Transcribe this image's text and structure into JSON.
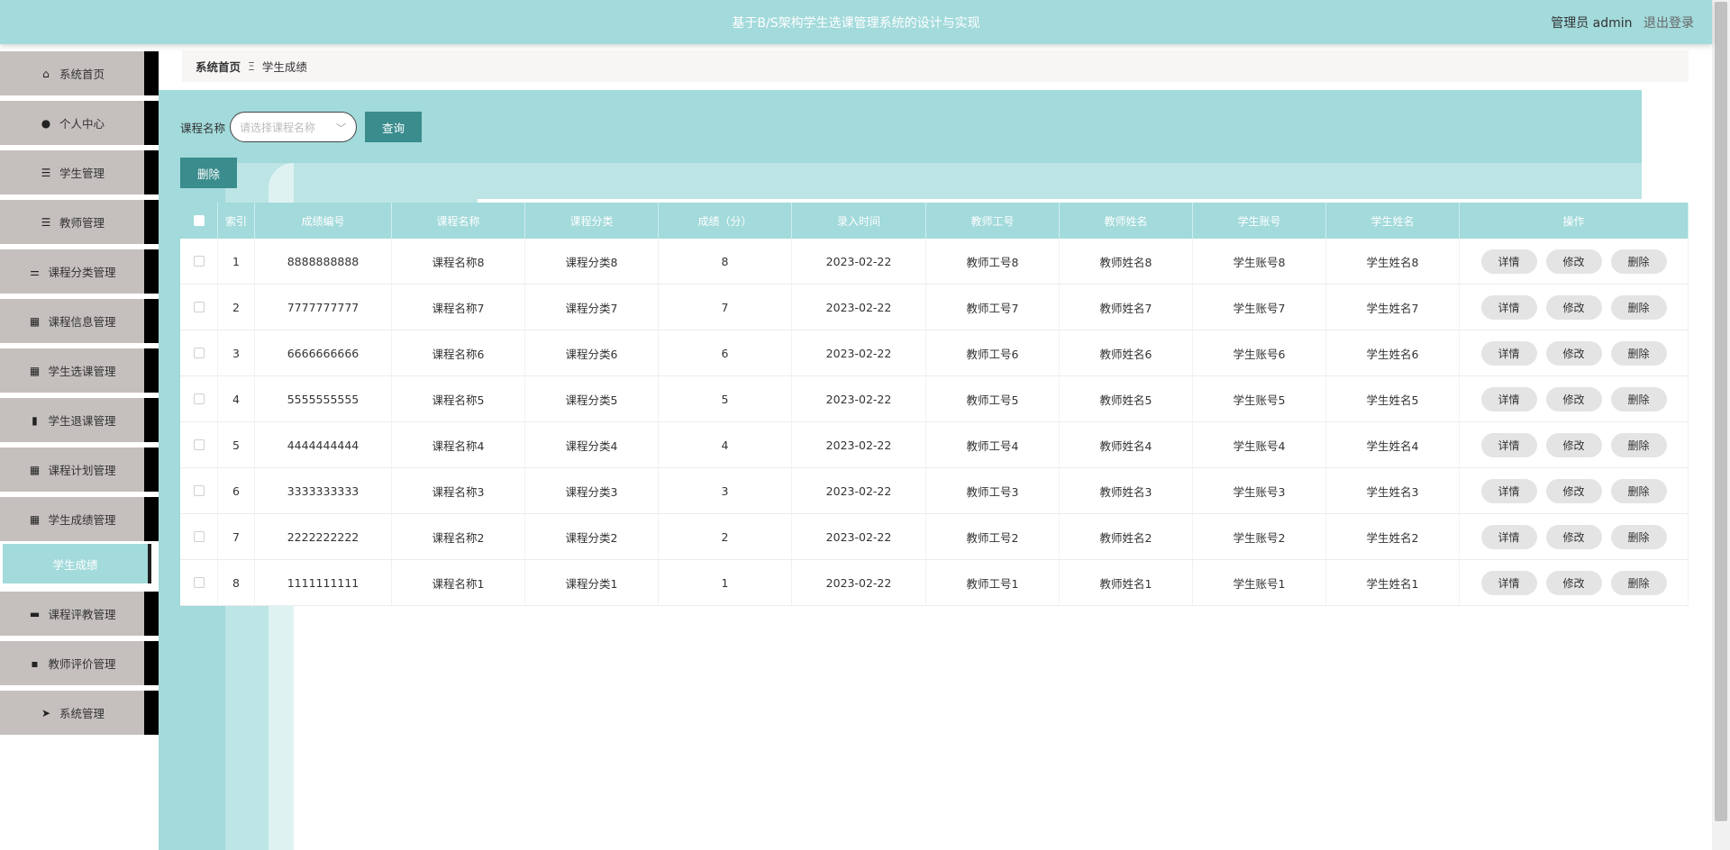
{
  "header": {
    "title": "基于B/S架构学生选课管理系统的设计与实现",
    "role_user": "管理员 admin",
    "logout": "退出登录"
  },
  "sidebar": {
    "items": [
      {
        "label": "系统首页",
        "icon": "home-icon",
        "glyph": "⌂"
      },
      {
        "label": "个人中心",
        "icon": "user-icon",
        "glyph": "●"
      },
      {
        "label": "学生管理",
        "icon": "list-icon",
        "glyph": "☰"
      },
      {
        "label": "教师管理",
        "icon": "list-icon",
        "glyph": "☰"
      },
      {
        "label": "课程分类管理",
        "icon": "sliders-icon",
        "glyph": "⚌"
      },
      {
        "label": "课程信息管理",
        "icon": "grid-icon",
        "glyph": "▦"
      },
      {
        "label": "学生选课管理",
        "icon": "grid-icon",
        "glyph": "▦"
      },
      {
        "label": "学生退课管理",
        "icon": "book-icon",
        "glyph": "▮"
      },
      {
        "label": "课程计划管理",
        "icon": "grid-icon",
        "glyph": "▦"
      },
      {
        "label": "学生成绩管理",
        "icon": "grid-icon",
        "glyph": "▦"
      },
      {
        "label": "课程评教管理",
        "icon": "monitor-icon",
        "glyph": "▬"
      },
      {
        "label": "教师评价管理",
        "icon": "chat-icon",
        "glyph": "▪"
      },
      {
        "label": "系统管理",
        "icon": "send-icon",
        "glyph": "➤"
      }
    ],
    "active_sub": "学生成绩"
  },
  "breadcrumb": {
    "home": "系统首页",
    "sep": "Ξ",
    "current": "学生成绩"
  },
  "search": {
    "label": "课程名称",
    "placeholder": "请选择课程名称",
    "query_button": "查询",
    "delete_button": "删除"
  },
  "table": {
    "headers": [
      "",
      "索引",
      "成绩编号",
      "课程名称",
      "课程分类",
      "成绩（分）",
      "录入时间",
      "教师工号",
      "教师姓名",
      "学生账号",
      "学生姓名",
      "操作"
    ],
    "ops": {
      "detail": "详情",
      "edit": "修改",
      "delete": "删除"
    },
    "rows": [
      {
        "index": "1",
        "code": "8888888888",
        "course": "课程名称8",
        "category": "课程分类8",
        "score": "8",
        "date": "2023-02-22",
        "tid": "教师工号8",
        "tname": "教师姓名8",
        "sid": "学生账号8",
        "sname": "学生姓名8"
      },
      {
        "index": "2",
        "code": "7777777777",
        "course": "课程名称7",
        "category": "课程分类7",
        "score": "7",
        "date": "2023-02-22",
        "tid": "教师工号7",
        "tname": "教师姓名7",
        "sid": "学生账号7",
        "sname": "学生姓名7"
      },
      {
        "index": "3",
        "code": "6666666666",
        "course": "课程名称6",
        "category": "课程分类6",
        "score": "6",
        "date": "2023-02-22",
        "tid": "教师工号6",
        "tname": "教师姓名6",
        "sid": "学生账号6",
        "sname": "学生姓名6"
      },
      {
        "index": "4",
        "code": "5555555555",
        "course": "课程名称5",
        "category": "课程分类5",
        "score": "5",
        "date": "2023-02-22",
        "tid": "教师工号5",
        "tname": "教师姓名5",
        "sid": "学生账号5",
        "sname": "学生姓名5"
      },
      {
        "index": "5",
        "code": "4444444444",
        "course": "课程名称4",
        "category": "课程分类4",
        "score": "4",
        "date": "2023-02-22",
        "tid": "教师工号4",
        "tname": "教师姓名4",
        "sid": "学生账号4",
        "sname": "学生姓名4"
      },
      {
        "index": "6",
        "code": "3333333333",
        "course": "课程名称3",
        "category": "课程分类3",
        "score": "3",
        "date": "2023-02-22",
        "tid": "教师工号3",
        "tname": "教师姓名3",
        "sid": "学生账号3",
        "sname": "学生姓名3"
      },
      {
        "index": "7",
        "code": "2222222222",
        "course": "课程名称2",
        "category": "课程分类2",
        "score": "2",
        "date": "2023-02-22",
        "tid": "教师工号2",
        "tname": "教师姓名2",
        "sid": "学生账号2",
        "sname": "学生姓名2"
      },
      {
        "index": "8",
        "code": "1111111111",
        "course": "课程名称1",
        "category": "课程分类1",
        "score": "1",
        "date": "2023-02-22",
        "tid": "教师工号1",
        "tname": "教师姓名1",
        "sid": "学生账号1",
        "sname": "学生姓名1"
      }
    ]
  },
  "colors": {
    "accent": "#a3dadb",
    "button": "#3a8c8d",
    "sidebar_item": "#c5c0be"
  }
}
